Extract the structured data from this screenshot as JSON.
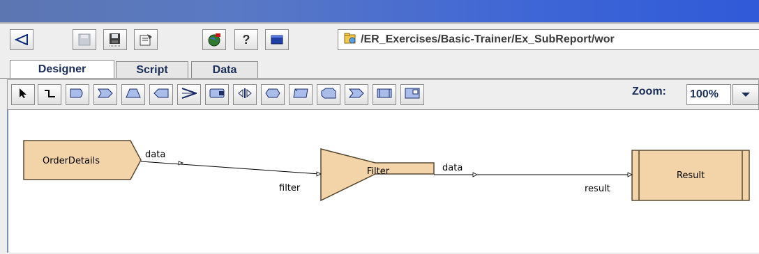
{
  "toolbar": {
    "path": "/ER_Exercises/Basic-Trainer/Ex_SubReport/wor",
    "icons": [
      "back-icon",
      "save-disabled-icon",
      "save-icon",
      "properties-icon",
      "globe-icon",
      "help-icon",
      "window-icon",
      "folder-icon"
    ]
  },
  "tabs": [
    {
      "label": "Designer",
      "active": true
    },
    {
      "label": "Script",
      "active": false
    },
    {
      "label": "Data",
      "active": false
    }
  ],
  "palette": {
    "tools": [
      "pointer",
      "connector",
      "input-shape",
      "output-shape",
      "trapezoid",
      "pentagon-left",
      "merge",
      "sort",
      "split",
      "hexagon",
      "parallelogram",
      "octagon",
      "chevron",
      "process",
      "subreport"
    ],
    "zoom_label": "Zoom:",
    "zoom_value": "100%"
  },
  "diagram": {
    "nodes": [
      {
        "id": "order",
        "label": "OrderDetails"
      },
      {
        "id": "filter",
        "label": "Filter"
      },
      {
        "id": "result",
        "label": "Result"
      }
    ],
    "edges": [
      {
        "from": "order",
        "out_label": "data",
        "to": "filter",
        "in_label": "filter"
      },
      {
        "from": "filter",
        "out_label": "data",
        "to": "result",
        "in_label": "result"
      }
    ],
    "node_fill": "#f3d3a8",
    "node_stroke": "#5a4a32"
  }
}
